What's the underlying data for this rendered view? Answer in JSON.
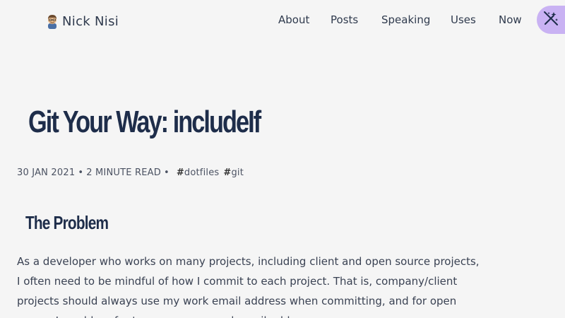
{
  "header": {
    "brand_name": "Nick Nisi",
    "nav": [
      {
        "label": "About"
      },
      {
        "label": "Posts"
      },
      {
        "label": "Speaking"
      },
      {
        "label": "Uses"
      },
      {
        "label": "Now"
      }
    ],
    "theme_toggle_icon": "wand-icon"
  },
  "post": {
    "title": "Git Your Way: includeIf",
    "date": "30 JAN 2021",
    "read_time": "2 MINUTE READ",
    "separator": "•",
    "tags": [
      {
        "hash": "#",
        "label": "dotfiles"
      },
      {
        "hash": "#",
        "label": "git"
      }
    ],
    "section_heading": "The Problem",
    "paragraph": "As a developer who works on many projects, including client and open source projects, I often need to be mindful of how I commit to each project. That is, company/client projects should always use my work email address when committing, and for open source I would prefer to use my personal email address."
  },
  "colors": {
    "background": "#f5f5f5",
    "heading": "#1e2d4a",
    "accent": "#c9b2f3"
  }
}
